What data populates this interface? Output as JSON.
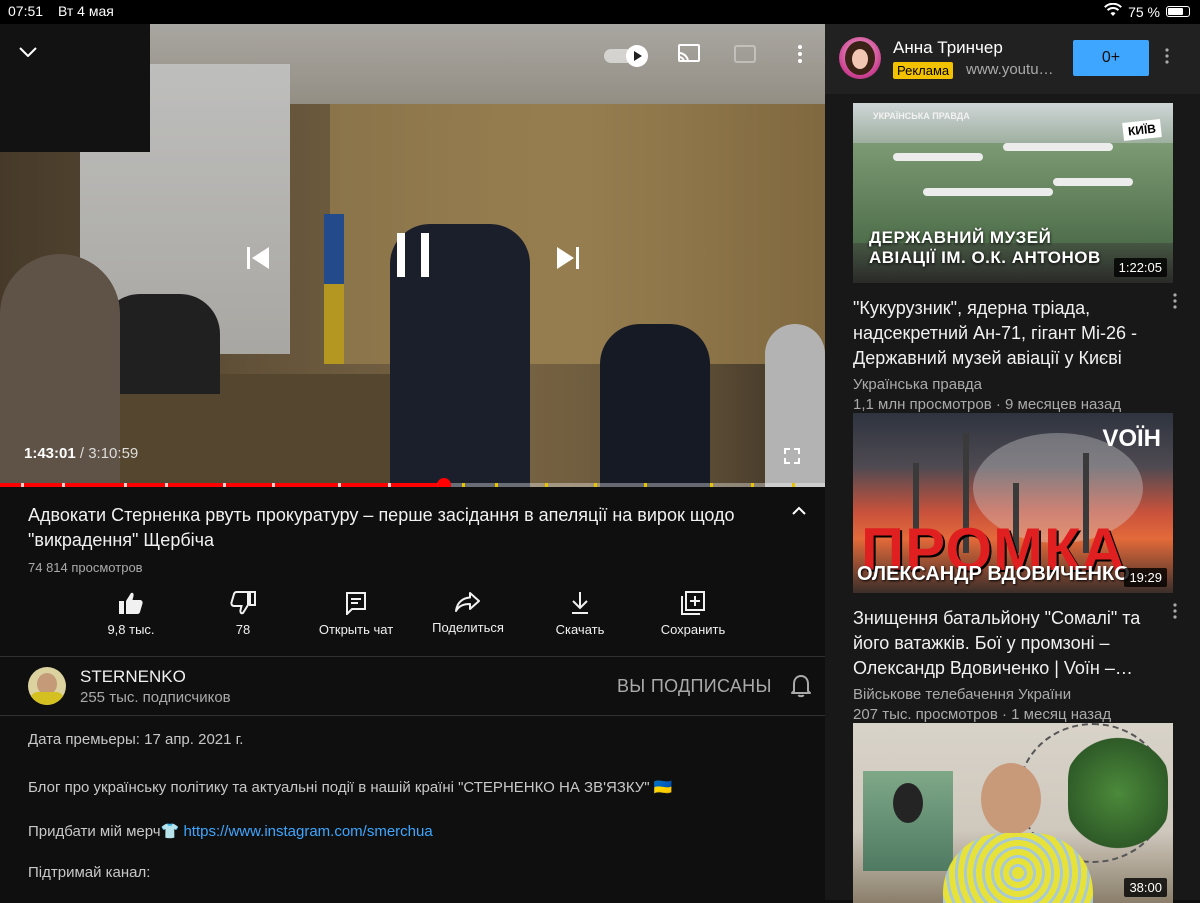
{
  "statusbar": {
    "time": "07:51",
    "date": "Вт 4 мая",
    "battery": "75 %",
    "battery_level": 0.75
  },
  "player": {
    "current_time": "1:43:01",
    "duration": " / 3:10:59",
    "progress": 0.538,
    "chapter_marks": [
      0.025,
      0.075,
      0.15,
      0.2,
      0.27,
      0.33,
      0.41,
      0.47,
      0.53,
      0.56,
      0.6,
      0.66,
      0.72,
      0.78,
      0.86,
      0.91,
      0.96
    ]
  },
  "video": {
    "title": "Адвокати Стерненка рвуть прокуратуру – перше засідання в апеляції на вирок щодо \"викрадення\" Щербіча",
    "views": "74 814 просмотров",
    "actions": {
      "like": "9,8 тыс.",
      "dislike": "78",
      "chat": "Открыть чат",
      "share": "Поделиться",
      "download": "Скачать",
      "save": "Сохранить"
    }
  },
  "channel": {
    "name": "STERNENKO",
    "subscribers": "255 тыс. подписчиков",
    "subscribe_state": "ВЫ ПОДПИСАНЫ"
  },
  "description": {
    "premiere": "Дата премьеры: 17 апр. 2021 г.",
    "blog": "Блог про українську політику та актуальні події в нашій країні \"СТЕРНЕНКО НА ЗВ'ЯЗКУ\" 🇺🇦",
    "merch_text": "Придбати мій мерч👕 ",
    "merch_link": "https://www.instagram.com/smerchua",
    "support": "Підтримай канал:"
  },
  "ad": {
    "name": "Анна Тринчер",
    "badge": "Реклама",
    "url": "www.youtube.com",
    "button": "0+"
  },
  "recommendations": [
    {
      "title": "\"Кукурузник\", ядерна тріада, надсекретний Ан-71, гігант Мі-26 - Державний музей авіації у Києві",
      "channel": "Українська правда",
      "meta": "1,1 млн просмотров · 9 месяцев назад",
      "duration": "1:22:05",
      "thumb_text": [
        "ДЕРЖАВНИЙ МУЗЕЙ",
        "АВІАЦІЇ ІМ. О.К. АНТОНОВ"
      ],
      "thumb_badge": "КИЇВ",
      "thumb_brand": "УКРАЇНСЬКА ПРАВДА"
    },
    {
      "title": "Знищення батальйону \"Сомалі\" та його ватажків. Бої у промзоні – Олександр Вдовиченко | Voїн –…",
      "channel": "Військове телебачення України",
      "meta": "207 тыс. просмотров · 1 месяц назад",
      "duration": "19:29",
      "thumb_text": [
        "ПРОМКА",
        "ОЛЕКСАНДР ВДОВИЧЕНКО"
      ],
      "thumb_badge": "VOЇН"
    },
    {
      "duration": "38:00"
    }
  ],
  "colors": {
    "accent": "#ff0000",
    "link": "#3ea6ff",
    "ad_badge": "#f2c200",
    "background": "#0f0f0f"
  }
}
